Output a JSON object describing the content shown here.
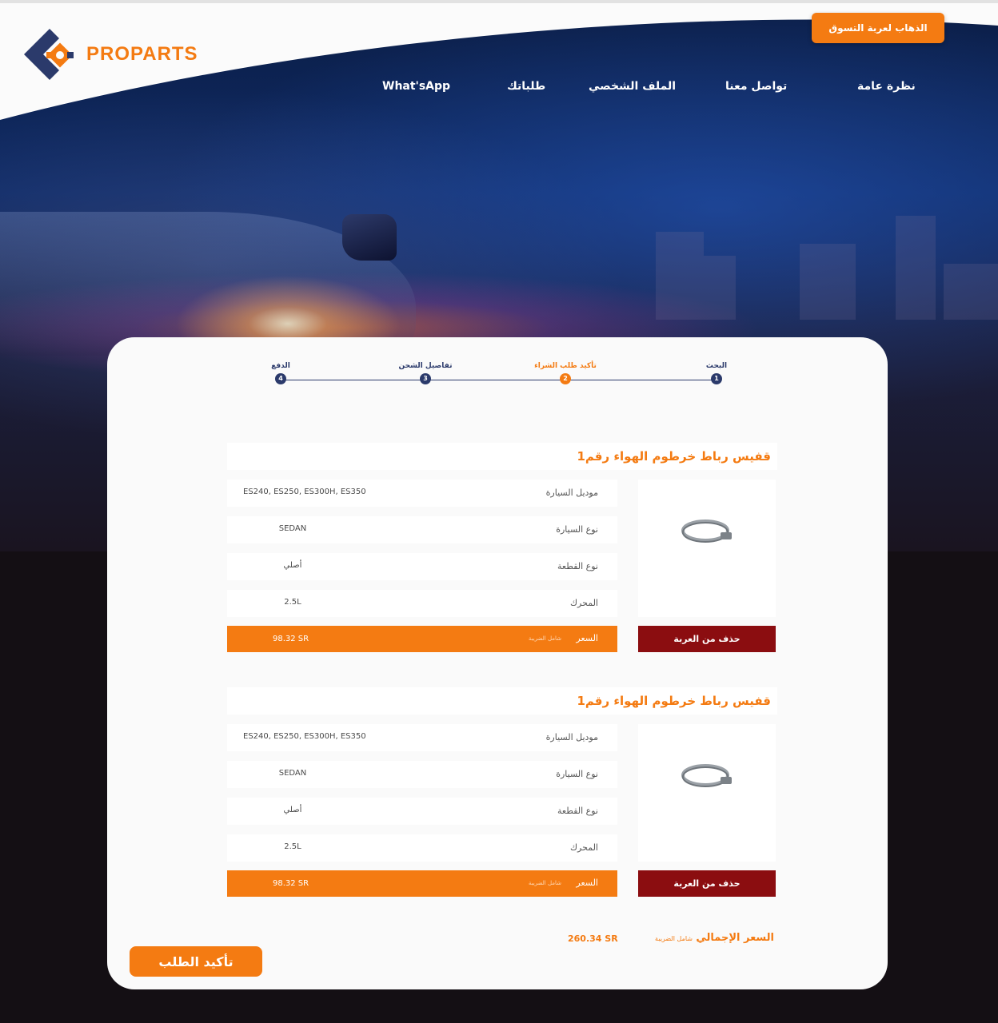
{
  "brand": {
    "logo_text": "PROPARTS",
    "accent": "#f47b12",
    "navy": "#2b3a6b",
    "danger": "#8b0d10"
  },
  "header": {
    "go_cart_label": "الذهاب لعربة التسوق",
    "nav": [
      {
        "label": "نظرة عامة"
      },
      {
        "label": "تواصل معنا"
      },
      {
        "label": "الملف الشخصي"
      },
      {
        "label": "طلباتك"
      },
      {
        "label": "What'sApp"
      }
    ]
  },
  "stepper": {
    "steps": [
      {
        "number": "1",
        "label": "البحث"
      },
      {
        "number": "2",
        "label": "تأكيد طلب الشراء",
        "active": true
      },
      {
        "number": "3",
        "label": "تفاصيل الشحن"
      },
      {
        "number": "4",
        "label": "الدفع"
      }
    ]
  },
  "products": [
    {
      "title": "قفيس رباط خرطوم الهواء رقم1",
      "image_icon": "hose-clamp-icon",
      "specs": [
        {
          "label": "موديل السيارة",
          "value": "ES240, ES250, ES300H, ES350"
        },
        {
          "label": "نوع السيارة",
          "value": "SEDAN"
        },
        {
          "label": "نوع القطعة",
          "value": "أصلي"
        },
        {
          "label": "المحرك",
          "value": "2.5L"
        }
      ],
      "price_label": "السعر",
      "price_note": "شامل الضريبة",
      "price_value": "98.32 SR",
      "remove_label": "حذف من العربة"
    },
    {
      "title": "قفيس رباط خرطوم الهواء رقم1",
      "image_icon": "hose-clamp-icon",
      "specs": [
        {
          "label": "موديل السيارة",
          "value": "ES240, ES250, ES300H, ES350"
        },
        {
          "label": "نوع السيارة",
          "value": "SEDAN"
        },
        {
          "label": "نوع القطعة",
          "value": "أصلي"
        },
        {
          "label": "المحرك",
          "value": "2.5L"
        }
      ],
      "price_label": "السعر",
      "price_note": "شامل الضريبة",
      "price_value": "98.32 SR",
      "remove_label": "حذف من العربة"
    }
  ],
  "summary": {
    "total_label": "السعر الإجمالي",
    "total_note": "شامل الضريبة",
    "total_value": "260.34 SR",
    "confirm_label": "تأكيد الطلب"
  }
}
